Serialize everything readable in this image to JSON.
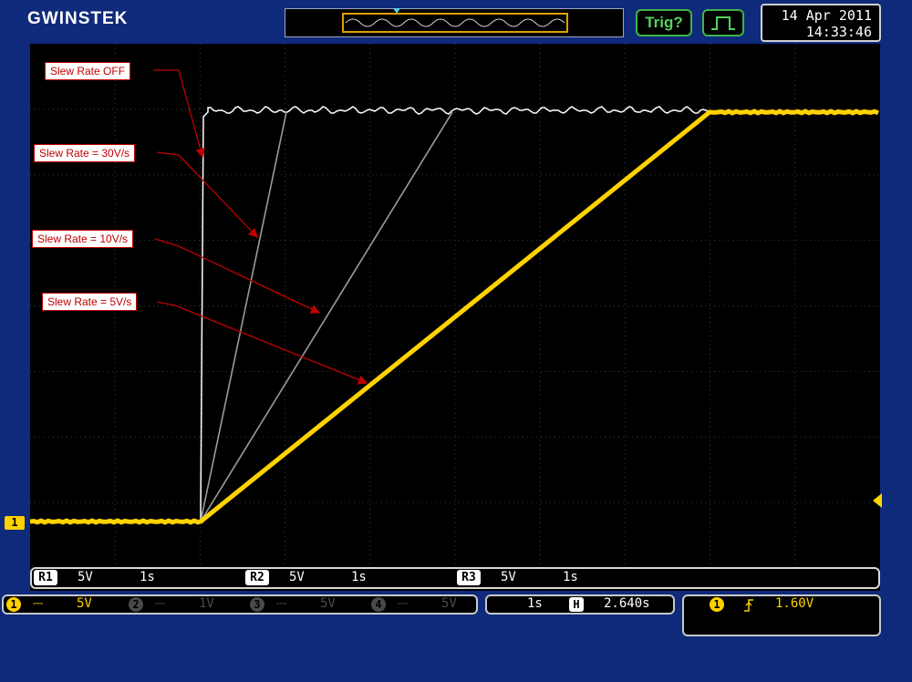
{
  "brand": {
    "logo": "GWINSTEK"
  },
  "header": {
    "trigger_status": "Trig?",
    "acquire_icon": "pulse-icon",
    "date": "14 Apr 2011",
    "time": "14:33:46"
  },
  "annotations": [
    {
      "label": "Slew Rate OFF"
    },
    {
      "label": "Slew Rate = 30V/s"
    },
    {
      "label": "Slew Rate = 10V/s"
    },
    {
      "label": "Slew Rate = 5V/s"
    }
  ],
  "references": [
    {
      "id": "R1",
      "volts": "5V",
      "time": "1s"
    },
    {
      "id": "R2",
      "volts": "5V",
      "time": "1s"
    },
    {
      "id": "R3",
      "volts": "5V",
      "time": "1s"
    }
  ],
  "channels": [
    {
      "num": "1",
      "coupling": "DC",
      "scale": "5V",
      "color": "#ffd200",
      "active": true
    },
    {
      "num": "2",
      "coupling": "DC",
      "scale": "1V",
      "color": "#5a5a5a",
      "active": false
    },
    {
      "num": "3",
      "coupling": "DC",
      "scale": "5V",
      "color": "#5a5a5a",
      "active": false
    },
    {
      "num": "4",
      "coupling": "DC",
      "scale": "5V",
      "color": "#5a5a5a",
      "active": false
    }
  ],
  "channel_marker": "1",
  "timebase": {
    "scale": "1s",
    "h_icon": "H",
    "position": "2.640s"
  },
  "trigger": {
    "source": "1",
    "slope_icon": "rising-edge-icon",
    "level": "1.60V"
  },
  "colors": {
    "ch1": "#ffd200",
    "ref_off": "#ffffff",
    "ref_gray": "#9a9a9a",
    "callout": "#c00000",
    "frame": "#0f2a7a"
  }
}
